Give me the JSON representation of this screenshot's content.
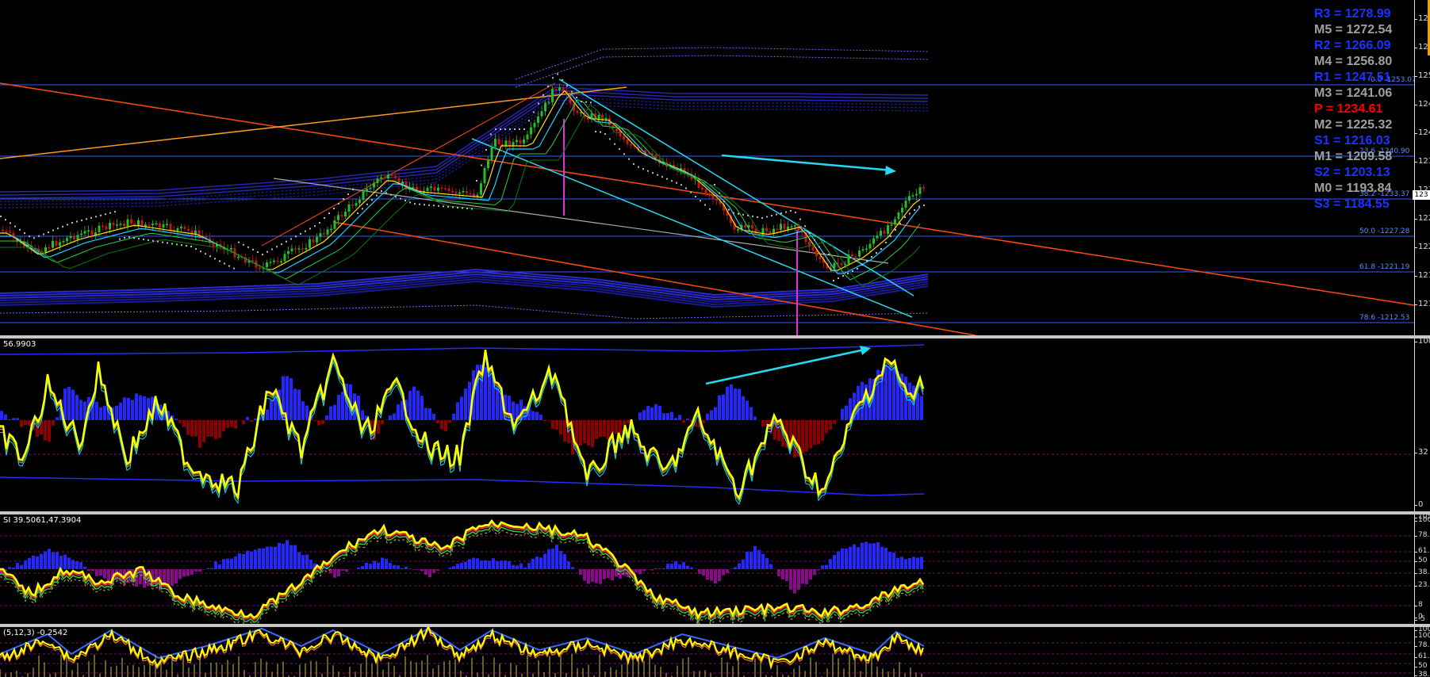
{
  "colors": {
    "background": "#000000",
    "pivot_resistance": "#1a33ff",
    "pivot_mid": "#a0a0a0",
    "pivot_main": "#ff0000",
    "channel": "#ff4a10",
    "cyan_arrow": "#25d9f0",
    "candle_up": "#22c022",
    "candle_down": "#c01818",
    "oscillator_yellow": "#ffff00",
    "histogram_blue": "#2626ff",
    "histogram_red": "#8b0000",
    "histogram_purple": "#8a0a8a"
  },
  "pivots": [
    {
      "label": "R3 = 1278.99",
      "kind": "resistance"
    },
    {
      "label": "M5 = 1272.54",
      "kind": "mid"
    },
    {
      "label": "R2 = 1266.09",
      "kind": "resistance"
    },
    {
      "label": "M4 = 1256.80",
      "kind": "mid"
    },
    {
      "label": "R1 = 1247.51",
      "kind": "resistance"
    },
    {
      "label": "M3 = 1241.06",
      "kind": "mid"
    },
    {
      "label": "P   = 1234.61",
      "kind": "main"
    },
    {
      "label": "M2 = 1225.32",
      "kind": "mid"
    },
    {
      "label": "S1 = 1216.03",
      "kind": "resistance"
    },
    {
      "label": "M1 = 1209.58",
      "kind": "mid"
    },
    {
      "label": "S2 = 1203.13",
      "kind": "resistance"
    },
    {
      "label": "M0 = 1193.84",
      "kind": "mid"
    },
    {
      "label": "S3 = 1184.55",
      "kind": "resistance"
    }
  ],
  "fib_levels": [
    "0.0 -1253.07",
    "23.6 -1240.90",
    "38.2 -1233.37",
    "50.0 -1227.28",
    "61.8 -1221.19",
    "78.6 -1212.53"
  ],
  "main_scale": {
    "ticks": [
      "126",
      "125",
      "125",
      "124",
      "124",
      "123",
      "123",
      "122",
      "122",
      "121",
      "121"
    ],
    "current_price": "123"
  },
  "pane2": {
    "label": "56.9903",
    "ticks": [
      "100",
      "32",
      "0"
    ]
  },
  "pane3": {
    "label": "SI 39.5061,47.3904",
    "ticks": [
      "105",
      "100",
      "78.6",
      "61.8",
      "50",
      "38.2",
      "23.6",
      "8",
      "0",
      "-5"
    ]
  },
  "pane4": {
    "label": "(5,12,3) -0.2542",
    "ticks": [
      "100",
      "100",
      "78.6",
      "61.8",
      "50",
      "38.2"
    ]
  }
}
